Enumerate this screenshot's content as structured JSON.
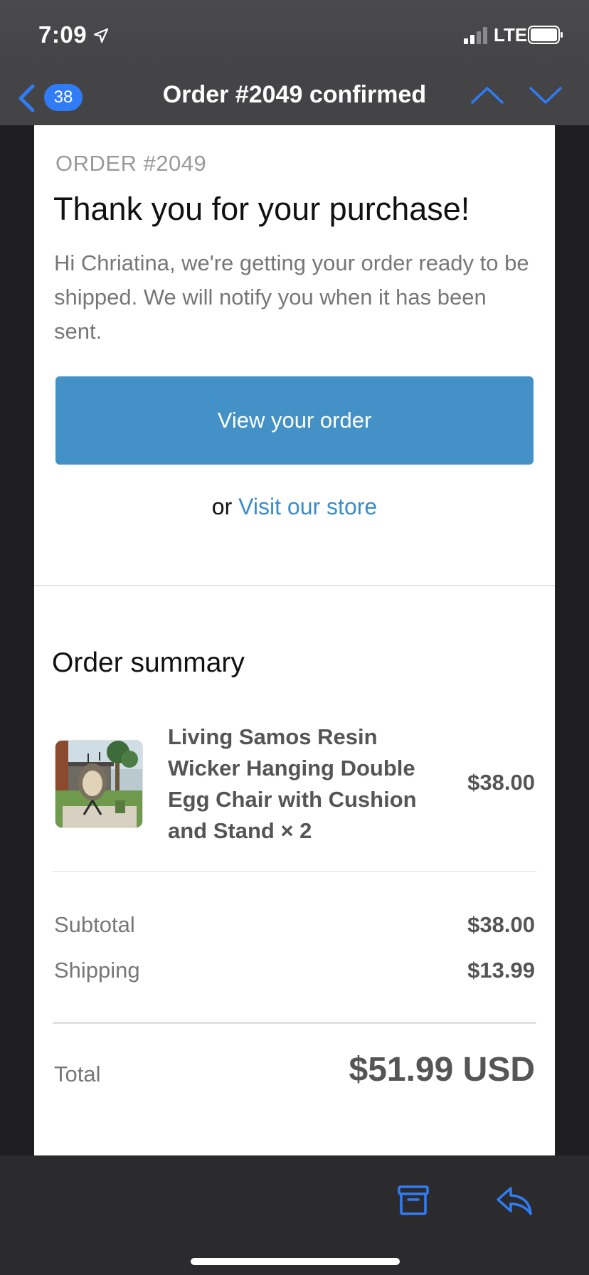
{
  "status_bar": {
    "time": "7:09",
    "carrier": "LTE"
  },
  "nav": {
    "unread_count": "38",
    "title": "Order #2049 confirmed"
  },
  "email": {
    "order_label": "ORDER #2049",
    "heading": "Thank you for your purchase!",
    "intro": "Hi Chriatina, we're getting your order ready to be shipped. We will notify you when it has been sent.",
    "view_order_button": "View your order",
    "or_text": "or",
    "store_link": "Visit our store",
    "summary_title": "Order summary",
    "item": {
      "name": "Living Samos Resin Wicker Hanging Double Egg Chair with Cushion and Stand × 2",
      "price": "$38.00"
    },
    "subtotal_label": "Subtotal",
    "subtotal_value": "$38.00",
    "shipping_label": "Shipping",
    "shipping_value": "$13.99",
    "total_label": "Total",
    "total_value": "$51.99 USD"
  },
  "colors": {
    "accent": "#2f7cf6",
    "button": "#4391c6",
    "link": "#3b8ccb"
  },
  "icons": {
    "status": [
      "location-arrow-icon",
      "signal-icon",
      "battery-icon"
    ],
    "nav": [
      "chevron-left-icon",
      "chevron-up-icon",
      "chevron-down-icon"
    ],
    "toolbar": [
      "archive-icon",
      "reply-icon"
    ]
  }
}
